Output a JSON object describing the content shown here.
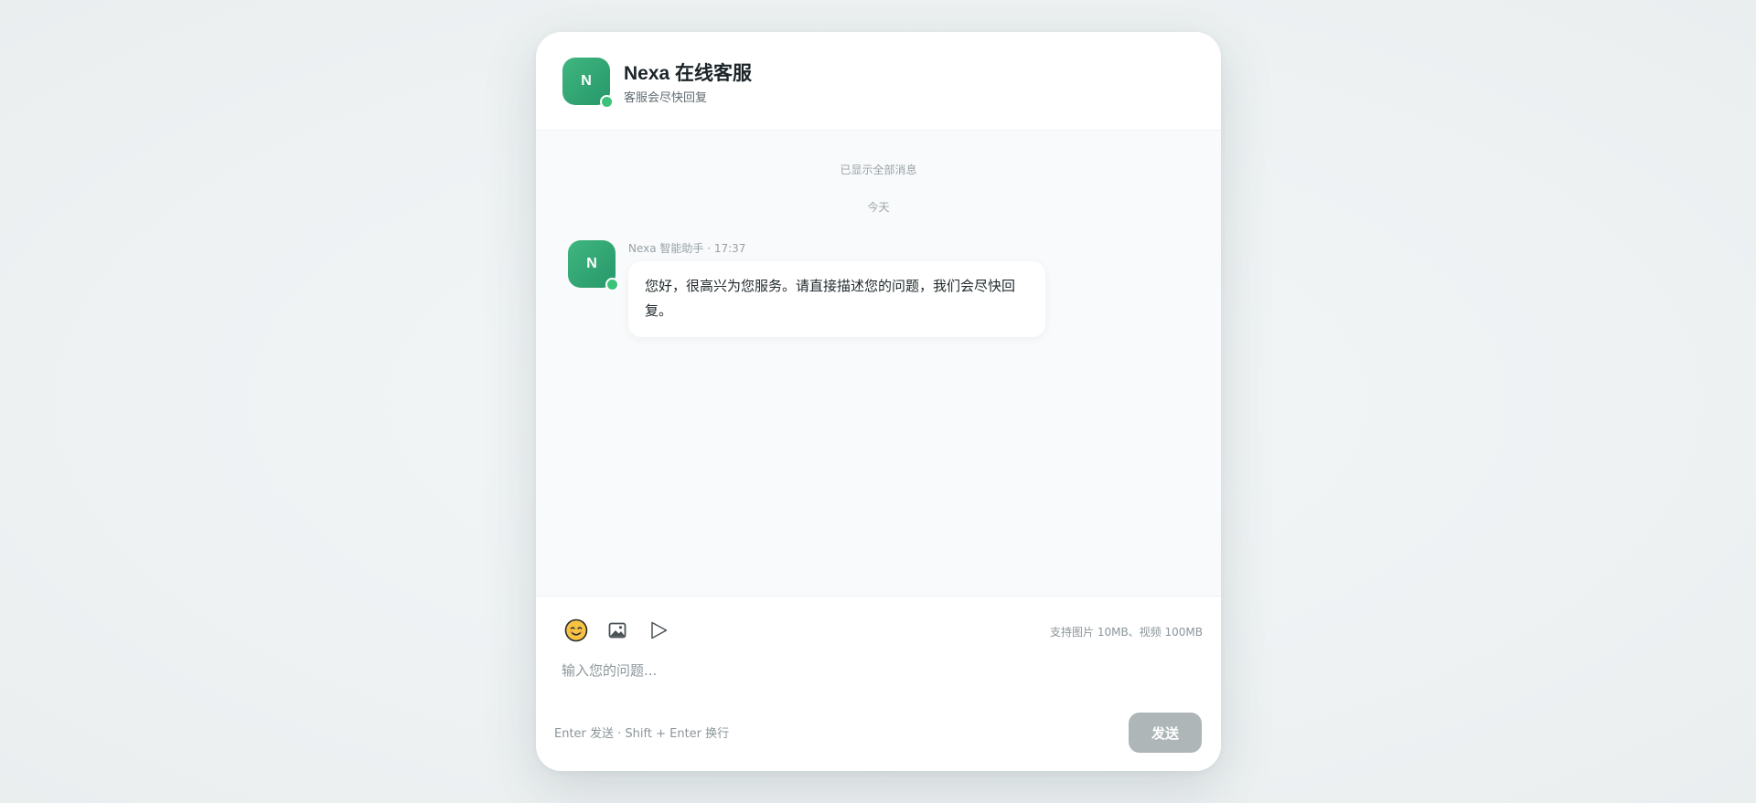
{
  "header": {
    "avatar_letter": "N",
    "title": "Nexa 在线客服",
    "subtitle": "客服会尽快回复"
  },
  "messages": {
    "all_shown_note": "已显示全部消息",
    "date_divider": "今天",
    "items": [
      {
        "avatar_letter": "N",
        "meta": "Nexa 智能助手 · 17:37",
        "text": "您好，很高兴为您服务。请直接描述您的问题，我们会尽快回复。"
      }
    ]
  },
  "composer": {
    "tools": [
      {
        "icon": "emoji-icon"
      },
      {
        "icon": "image-icon"
      },
      {
        "icon": "video-icon"
      }
    ],
    "upload_limit": "支持图片 10MB、视频 100MB",
    "input_placeholder": "输入您的问题...",
    "input_value": "",
    "hint": "Enter 发送 · Shift + Enter 换行",
    "send_label": "发送"
  },
  "colors": {
    "brand_green": "#2fa874",
    "online_green": "#3cc27a",
    "send_disabled": "#aeb6b8"
  }
}
